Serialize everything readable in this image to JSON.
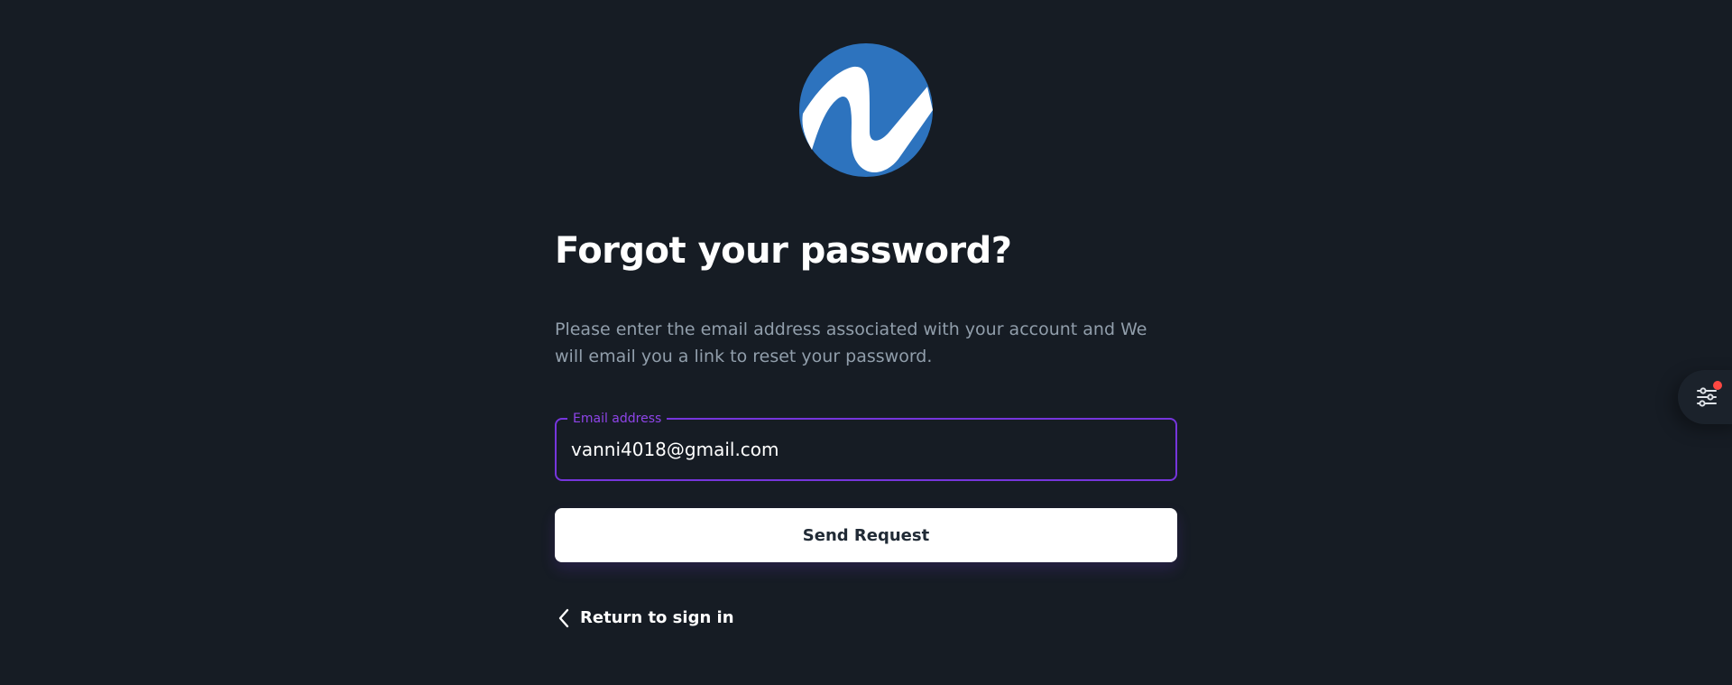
{
  "page": {
    "title": "Forgot your password?",
    "description": "Please enter the email address associated with your account and We will email you a link to reset your password."
  },
  "form": {
    "email_label": "Email address",
    "email_value": "vanni4018@gmail.com",
    "submit_label": "Send Request"
  },
  "footer": {
    "return_label": "Return to sign in"
  },
  "icons": {
    "logo": "brand-logo",
    "back": "chevron-left-icon",
    "settings": "sliders-icon"
  },
  "colors": {
    "background": "#161c24",
    "accent": "#7635dc",
    "logo_blue": "#2d73be",
    "notification_dot": "#ff4842",
    "muted_text": "#919eab"
  }
}
